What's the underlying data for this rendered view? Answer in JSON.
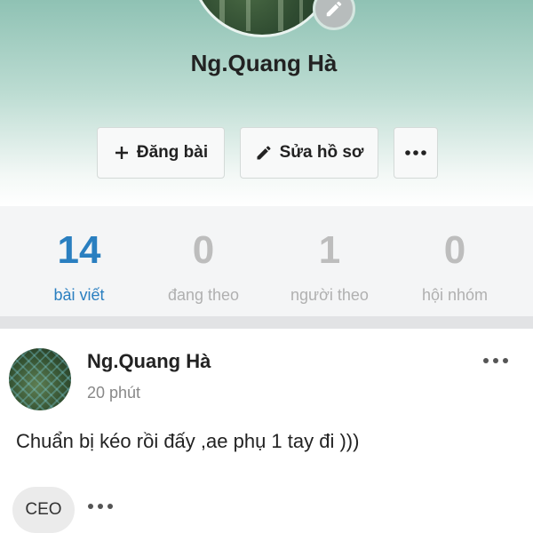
{
  "profile": {
    "name": "Ng.Quang Hà"
  },
  "actions": {
    "post_label": "Đăng bài",
    "edit_profile_label": "Sửa hồ sơ"
  },
  "stats": [
    {
      "value": "14",
      "label": "bài viết",
      "active": true
    },
    {
      "value": "0",
      "label": "đang theo",
      "active": false
    },
    {
      "value": "1",
      "label": "người theo",
      "active": false
    },
    {
      "value": "0",
      "label": "hội nhóm",
      "active": false
    }
  ],
  "post": {
    "author": "Ng.Quang Hà",
    "time": "20 phút",
    "text": "Chuẩn bị kéo rồi đấy ,ae phụ 1 tay đi )))",
    "tag": "CEO"
  },
  "icons": {
    "plus": "plus-icon",
    "pencil": "pencil-icon",
    "more": "more-horizontal-icon"
  },
  "colors": {
    "accent": "#2a7fc0",
    "header_gradient_top": "#8fc2b4",
    "inactive_stat": "#bdbdbd"
  }
}
